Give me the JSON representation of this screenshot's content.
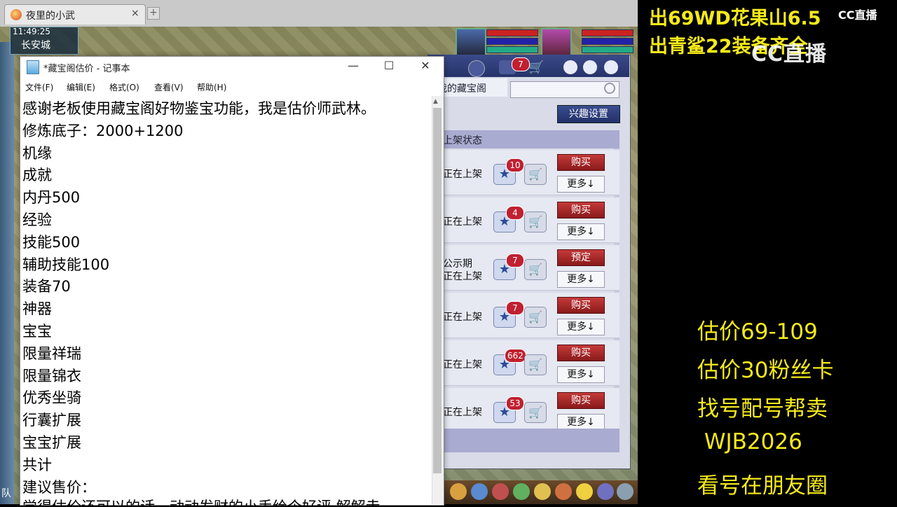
{
  "browser": {
    "tab_title": "夜里的小武",
    "tab_close": "×",
    "new_tab": "+"
  },
  "game": {
    "time": "11:49:25",
    "location": "长安城",
    "left_badge": "队"
  },
  "panel": {
    "tab_label": "我的藏宝阁",
    "interest_button": "兴趣设置",
    "column_header": "上架状态",
    "notifications_count": "7",
    "rows": [
      {
        "status": "正在上架",
        "favorites": "10",
        "action": "购买",
        "more": "更多↓"
      },
      {
        "status": "正在上架",
        "favorites": "4",
        "action": "购买",
        "more": "更多↓"
      },
      {
        "status": "公示期\n正在上架",
        "favorites": "7",
        "action": "预定",
        "more": "更多↓"
      },
      {
        "status": "正在上架",
        "favorites": "7",
        "action": "购买",
        "more": "更多↓"
      },
      {
        "status": "正在上架",
        "favorites": "662",
        "action": "购买",
        "more": "更多↓"
      },
      {
        "status": "正在上架",
        "favorites": "53",
        "action": "购买",
        "more": "更多↓"
      }
    ]
  },
  "notepad": {
    "title": "*藏宝阁估价 - 记事本",
    "controls": {
      "minimize": "—",
      "maximize": "☐",
      "close": "✕"
    },
    "menus": [
      "文件(F)",
      "编辑(E)",
      "格式(O)",
      "查看(V)",
      "帮助(H)"
    ],
    "lines": [
      "感谢老板使用藏宝阁好物鉴宝功能，我是估价师武林。",
      "修炼底子：2000+1200",
      "机缘",
      "成就",
      "内丹500",
      "经验",
      "技能500",
      "辅助技能100",
      "装备70",
      "神器",
      "宝宝",
      "限量祥瑞",
      "限量锦衣",
      "优秀坐骑",
      "行囊扩展",
      "宝宝扩展",
      "共计",
      "建议售价：",
      "觉得估价还可以的话，动动发财的小手给个好评 解解走"
    ]
  },
  "stream": {
    "top_lines": [
      "出69WD花果山6.5",
      "出青鲨22装备齐全"
    ],
    "logo_small": "CC直播",
    "logo_large": "CC直播",
    "info_lines": [
      "估价69-109",
      "估价30粉丝卡",
      "找号配号帮卖",
      " WJB2026",
      "看号在朋友圈"
    ]
  },
  "colors": {
    "overlay_text": "#f5ea1a",
    "buy_button": "#a82828",
    "panel_header": "#26336a"
  }
}
